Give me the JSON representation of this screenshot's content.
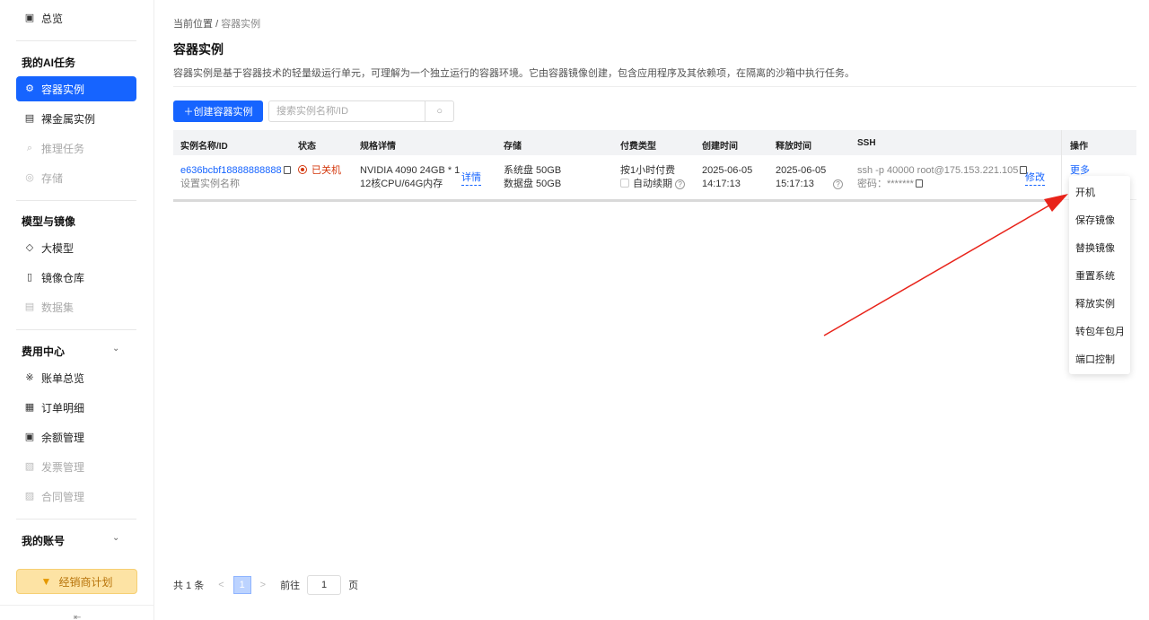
{
  "sidebar": {
    "overview": "总览",
    "group_ai": "我的AI任务",
    "ai_items": [
      "容器实例",
      "裸金属实例",
      "推理任务",
      "存储"
    ],
    "group_model": "模型与镜像",
    "model_items": [
      "大模型",
      "镜像仓库",
      "数据集"
    ],
    "group_billing": "费用中心",
    "billing_items": [
      "账单总览",
      "订单明细",
      "余额管理",
      "发票管理",
      "合同管理"
    ],
    "group_account": "我的账号",
    "dealer_button": "经销商计划",
    "collapse_icon": "⇤"
  },
  "breadcrumb": {
    "root": "当前位置",
    "sep": "/",
    "current": "容器实例"
  },
  "page": {
    "title": "容器实例",
    "description": "容器实例是基于容器技术的轻量级运行单元，可理解为一个独立运行的容器环境。它由容器镜像创建，包含应用程序及其依赖项，在隔离的沙箱中执行任务。"
  },
  "toolbar": {
    "create_label": "＋创建容器实例",
    "search_placeholder": "搜索实例名称/ID"
  },
  "table": {
    "headers": [
      "实例名称/ID",
      "状态",
      "规格详情",
      "存储",
      "付费类型",
      "创建时间",
      "释放时间",
      "SSH",
      "操作"
    ],
    "row": {
      "id": "e636bcbf18888888888",
      "name_hint": "设置实例名称",
      "status": "已关机",
      "spec_line1": "NVIDIA 4090 24GB * 1",
      "spec_line2": "12核CPU/64G内存",
      "spec_detail": "详情",
      "storage_sys": "系统盘 50GB",
      "storage_data": "数据盘 50GB",
      "pay_type": "按1小时付费",
      "auto_renew": "自动续期",
      "created_date": "2025-06-05",
      "created_time": "14:17:13",
      "released_date": "2025-06-05",
      "released_time": "15:17:13",
      "ssh_cmd": "ssh -p 40000 root@175.153.221.105",
      "ssh_pwd": "密码：*******",
      "ssh_modify": "修改",
      "more": "更多"
    }
  },
  "dropdown": [
    "开机",
    "保存镜像",
    "替换镜像",
    "重置系统",
    "释放实例",
    "转包年包月",
    "端口控制"
  ],
  "pager": {
    "total": "共 1 条",
    "prev": "<",
    "page": "1",
    "next": ">",
    "goto": "前往",
    "goto_value": "1",
    "page_unit": "页"
  },
  "colors": {
    "accent": "#1664ff",
    "status_off": "#d4380d",
    "annotation_arrow": "#e8231a"
  }
}
